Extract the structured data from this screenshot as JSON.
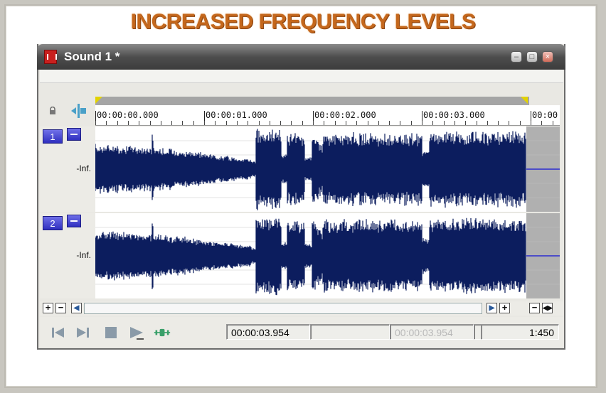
{
  "headline": "INCREASED FREQUENCY LEVELS",
  "window": {
    "title": "Sound 1 *"
  },
  "ruler": {
    "labels": [
      "00:00:00.000",
      "00:00:01.000",
      "00:00:02.000",
      "00:00:03.000",
      "00:00"
    ]
  },
  "tracks": [
    {
      "number": "1",
      "level": "-Inf."
    },
    {
      "number": "2",
      "level": "-Inf."
    }
  ],
  "transport": {
    "position": "00:00:03.954",
    "selection_end": "",
    "length": "00:00:03.954",
    "zoom": "1:450"
  },
  "scrollbar": {
    "zoom_in": "+",
    "zoom_out": "−",
    "plus_right": "+",
    "minus_right": "−"
  },
  "colors": {
    "waveform": "#0c1d5e",
    "accent_title": "#c4671c",
    "track_button": "#3a3ac8"
  },
  "icons": [
    "lock-icon",
    "snap-icon",
    "go-to-start-icon",
    "go-to-end-icon",
    "stop-icon",
    "play-icon",
    "loop-icon"
  ]
}
